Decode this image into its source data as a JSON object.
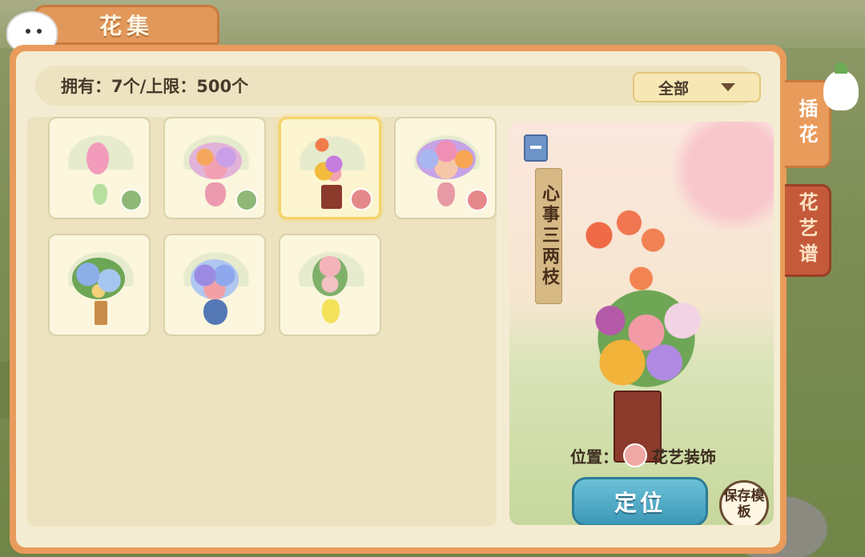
{
  "title": "花集",
  "owned_label": "拥有：7个/上限：500个",
  "filter": {
    "selected": "全部"
  },
  "side_tabs": [
    {
      "label": "插花",
      "active": true
    },
    {
      "label": "花艺谱",
      "active": false
    }
  ],
  "items": [
    {
      "id": 1,
      "badge": "green",
      "selected": false
    },
    {
      "id": 2,
      "badge": "green",
      "selected": false
    },
    {
      "id": 3,
      "badge": "pink",
      "selected": true
    },
    {
      "id": 4,
      "badge": "pink",
      "selected": false
    },
    {
      "id": 5,
      "badge": "",
      "selected": false
    },
    {
      "id": 6,
      "badge": "",
      "selected": false
    },
    {
      "id": 7,
      "badge": "",
      "selected": false
    }
  ],
  "preview": {
    "name": "心事三两枝",
    "location_label": "位置：",
    "location_value": "花艺装饰",
    "locate_button": "定位",
    "save_button": "保存模板"
  },
  "colors": {
    "panel": "#e99b5c",
    "locate": "#3c98b8",
    "badge_green": "#8fb877",
    "badge_pink": "#e5888a"
  }
}
